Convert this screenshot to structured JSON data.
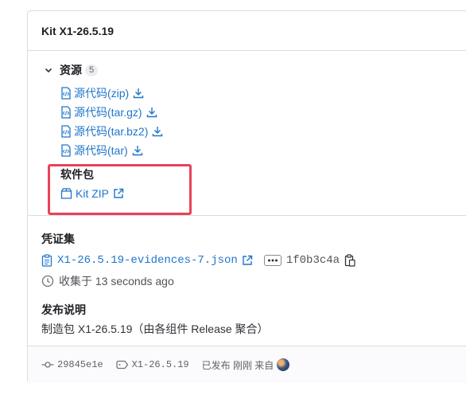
{
  "release": {
    "title": "Kit X1-26.5.19"
  },
  "assets": {
    "label": "资源",
    "count": "5",
    "sources": [
      {
        "label": "源代码(zip)"
      },
      {
        "label": "源代码(tar.gz)"
      },
      {
        "label": "源代码(tar.bz2)"
      },
      {
        "label": "源代码(tar)"
      }
    ],
    "packages_title": "软件包",
    "package_link": "Kit ZIP"
  },
  "evidence": {
    "title": "凭证集",
    "file": "X1-26.5.19-evidences-7.json",
    "sha": "1f0b3c4a",
    "collected": "收集于 13 seconds ago"
  },
  "notes": {
    "title": "发布说明",
    "text": "制造包 X1-26.5.19（由各组件 Release 聚合）"
  },
  "footer": {
    "commit": "29845e1e",
    "tag": "X1-26.5.19",
    "released_text": "已发布 刚刚 来自"
  },
  "colors": {
    "link": "#1f75cb",
    "highlight_box": "#e8425a",
    "border": "#dcdcde"
  }
}
